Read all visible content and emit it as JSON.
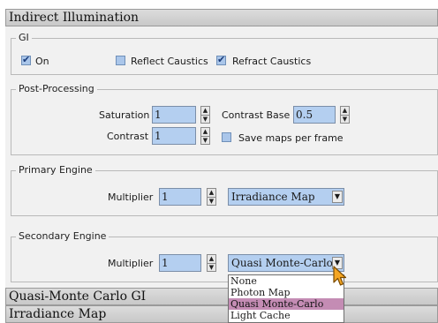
{
  "rollouts": {
    "indirect_title": "Indirect Illumination",
    "qmc_title": "Quasi-Monte Carlo GI",
    "irr_title": "Irradiance Map"
  },
  "gi": {
    "legend": "GI",
    "on_label": "On",
    "on_checked": true,
    "reflect_label": "Reflect Caustics",
    "reflect_checked": false,
    "refract_label": "Refract Caustics",
    "refract_checked": true
  },
  "post": {
    "legend": "Post-Processing",
    "saturation_label": "Saturation",
    "saturation_value": "1",
    "contrast_label": "Contrast",
    "contrast_value": "1",
    "contrast_base_label": "Contrast Base",
    "contrast_base_value": "0.5",
    "save_maps_label": "Save maps per frame",
    "save_maps_checked": false
  },
  "primary": {
    "legend": "Primary Engine",
    "multiplier_label": "Multiplier",
    "multiplier_value": "1",
    "engine": "Irradiance Map"
  },
  "secondary": {
    "legend": "Secondary Engine",
    "multiplier_label": "Multiplier",
    "multiplier_value": "1",
    "engine": "Quasi Monte-Carlo",
    "options": [
      "None",
      "Photon Map",
      "Quasi Monte-Carlo",
      "Light Cache"
    ],
    "selected_index": 2
  },
  "icons": {
    "spinner_up": "▲",
    "spinner_down": "▼",
    "dropdown_arrow": "▼"
  }
}
